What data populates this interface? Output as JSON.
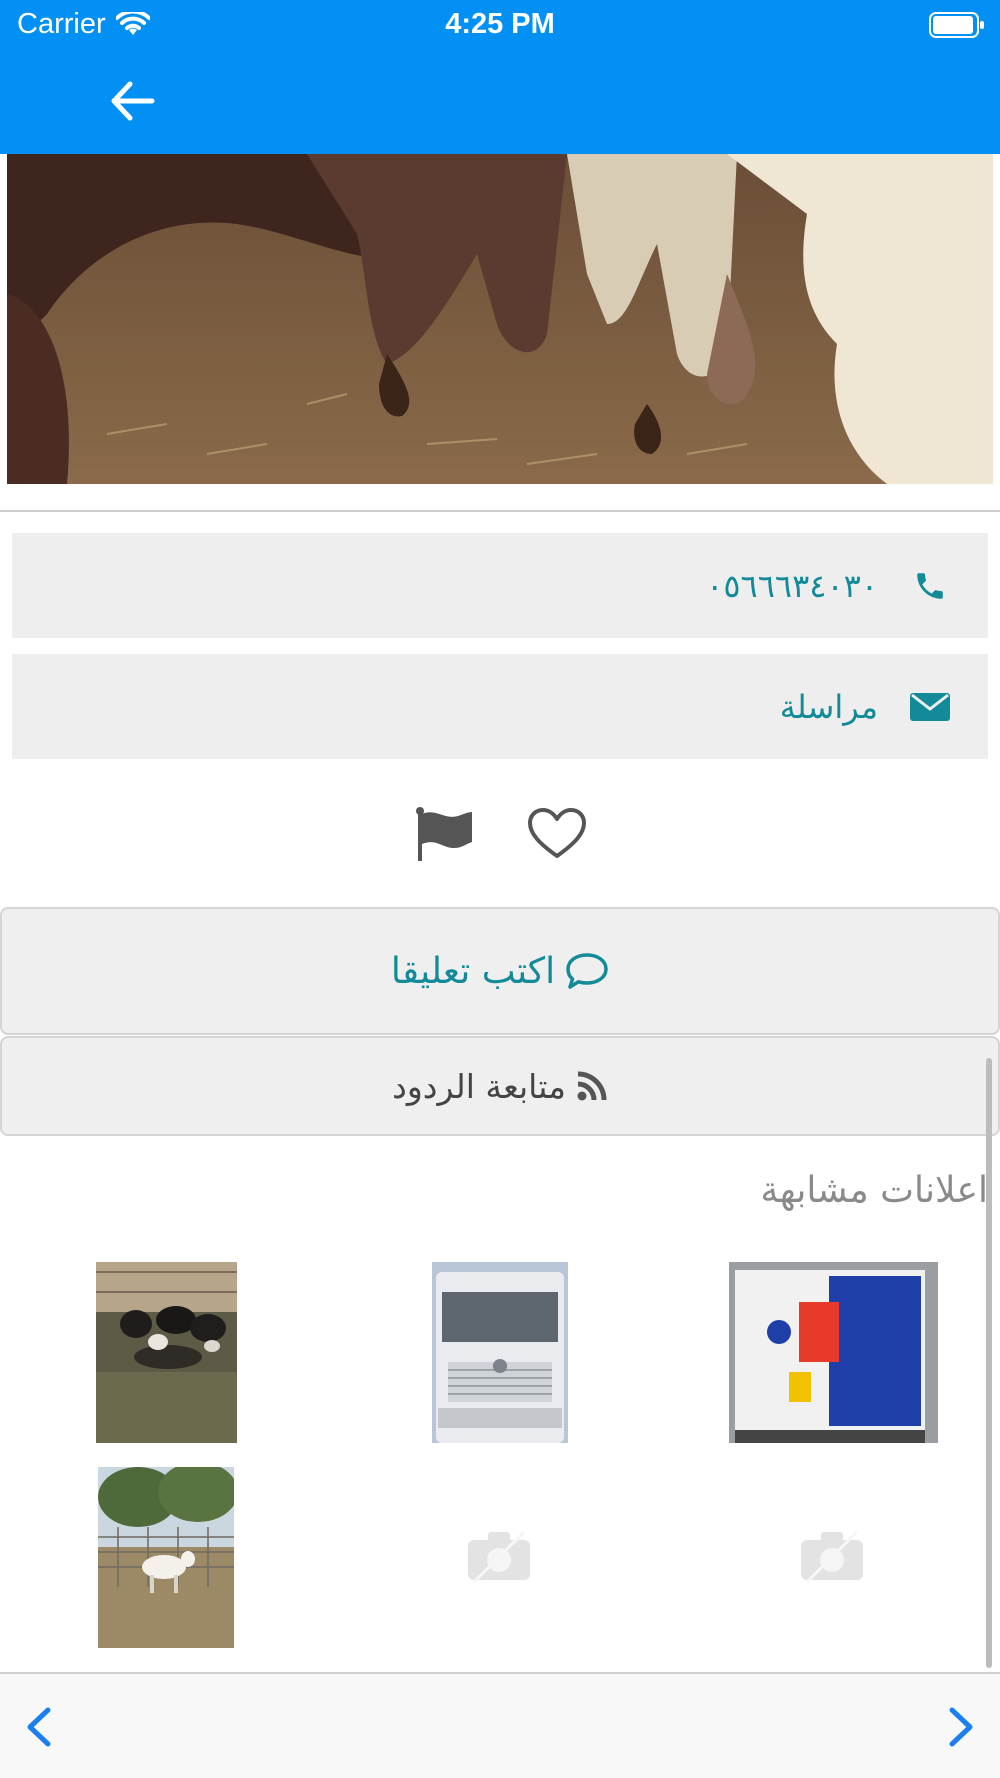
{
  "status_bar": {
    "carrier": "Carrier",
    "time": "4:25 PM"
  },
  "contact": {
    "phone": "٠٥٦٦٦٣٤٠٣٠",
    "message_label": "مراسلة"
  },
  "actions": {
    "write_comment": "اكتب تعليقا",
    "follow_replies": "متابعة الردود"
  },
  "similar_ads": {
    "title": "اعلانات مشابهة"
  },
  "colors": {
    "header": "#0290f5",
    "accent": "#128a98",
    "nav_blue": "#1a7ff0"
  }
}
